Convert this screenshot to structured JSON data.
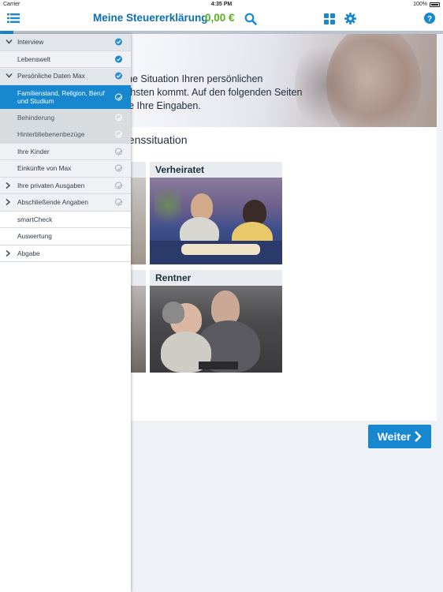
{
  "status": {
    "carrier": "Carrier",
    "time": "4:35 PM",
    "battery": "100%"
  },
  "navbar": {
    "title": "Meine Steuererklärung",
    "amount": "0,00 €",
    "progress_fraction": 0.03
  },
  "hero": {
    "line1": "lche Situation Ihren persönlichen",
    "line2": "ächsten kommt. Auf den folgenden Seiten",
    "line3": "Sie Ihre Eingaben."
  },
  "section_heading": "benssituation",
  "cards": {
    "married": "Verheiratet",
    "retired": "Rentner"
  },
  "button": {
    "next_label": "Weiter"
  },
  "sidebar": {
    "items": [
      {
        "label": "Interview",
        "expanded": true,
        "status": "done"
      },
      {
        "label": "Lebenswelt",
        "status": "done"
      },
      {
        "label": "Persönliche Daten Max",
        "expanded": true,
        "status": "done"
      },
      {
        "label_line1": "Familienstand, Religion, Beruf",
        "label_line2": "und Studium",
        "status": "active"
      },
      {
        "label": "Behinderung",
        "status": "open"
      },
      {
        "label": "Hinterbliebenenbezüge",
        "status": "open"
      },
      {
        "label": "Ihre Kinder",
        "status": "open"
      },
      {
        "label": "Einkünfte von Max",
        "status": "open"
      },
      {
        "label": "Ihre privaten Ausgaben",
        "status": "open"
      },
      {
        "label": "Abschließende Angaben",
        "status": "open"
      },
      {
        "label": "smartCheck"
      },
      {
        "label": "Auswertung"
      },
      {
        "label": "Abgabe"
      }
    ]
  },
  "colors": {
    "brand_blue": "#0b6fad",
    "accent_blue": "#1787d0",
    "amount_green": "#5ab01d"
  }
}
